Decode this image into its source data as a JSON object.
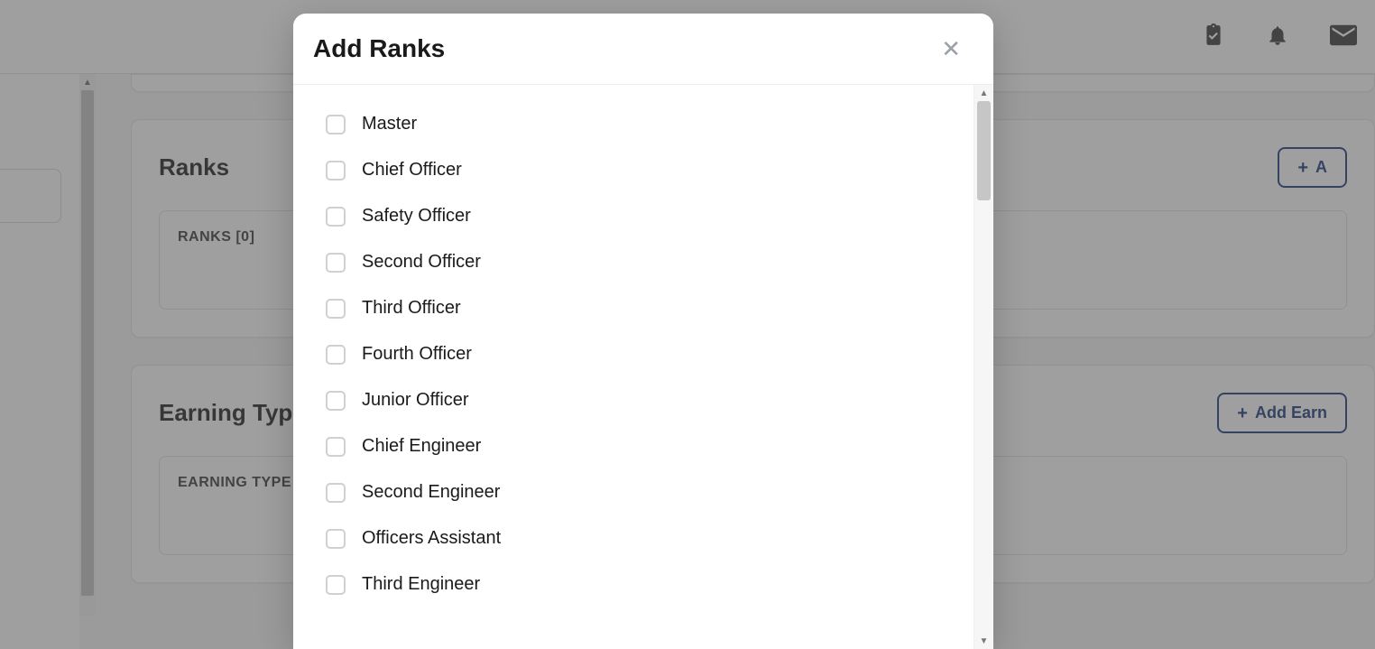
{
  "header": {
    "icons": [
      "clipboard-check-icon",
      "bell-icon",
      "mail-icon"
    ]
  },
  "sections": {
    "ranks": {
      "title": "Ranks",
      "add_button": "A",
      "table_header": "RANKS [0]"
    },
    "earning": {
      "title": "Earning Types",
      "add_button": "Add Earn",
      "table_header": "EARNING TYPE"
    }
  },
  "modal": {
    "title": "Add Ranks",
    "items": [
      "Master",
      "Chief Officer",
      "Safety Officer",
      "Second Officer",
      "Third Officer",
      "Fourth Officer",
      "Junior Officer",
      "Chief Engineer",
      "Second Engineer",
      "Officers Assistant",
      "Third Engineer"
    ]
  }
}
